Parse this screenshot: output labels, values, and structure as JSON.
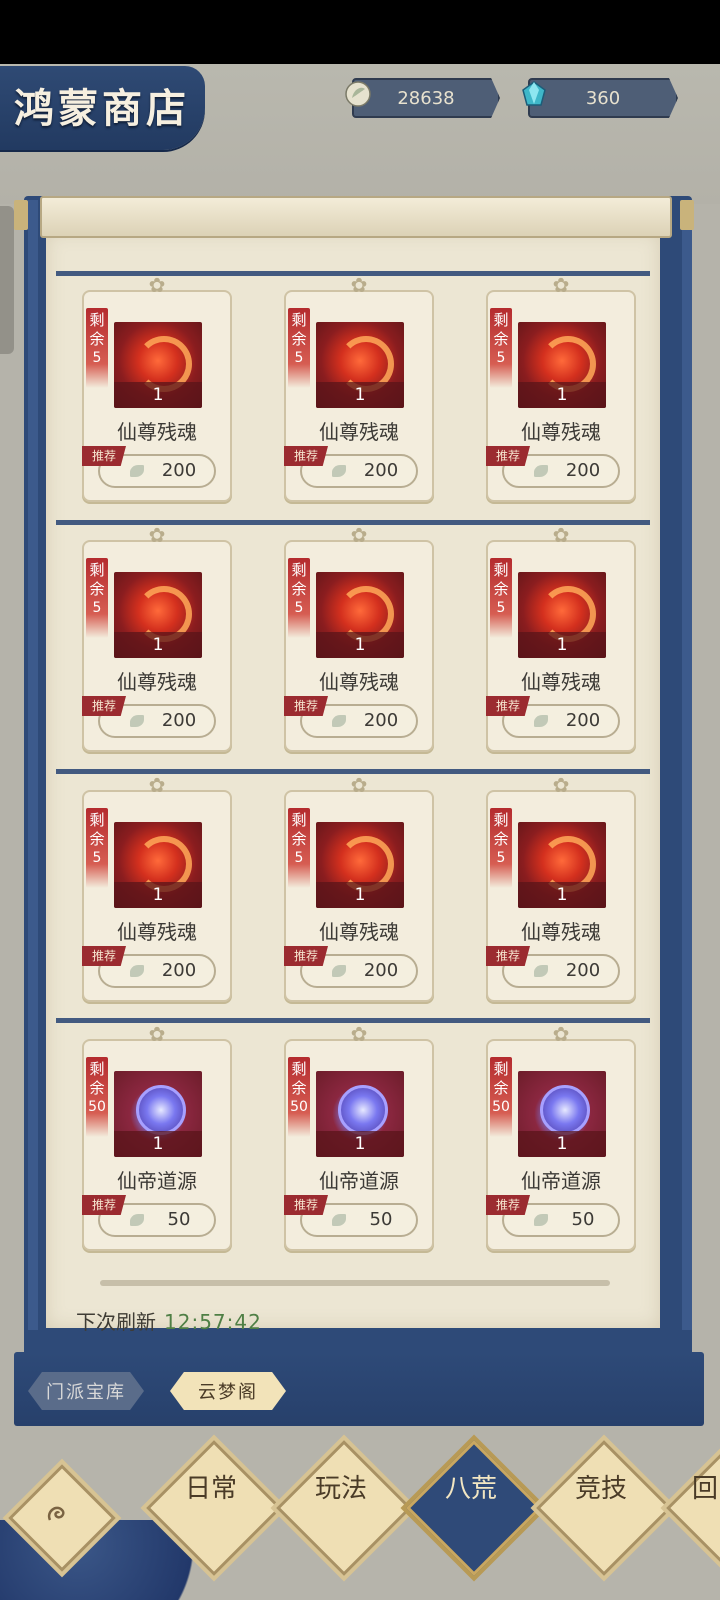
{
  "header": {
    "title": "鸿蒙商店",
    "currencies": [
      {
        "name": "leaf-currency-icon",
        "amount": "28638"
      },
      {
        "name": "gem-currency-icon",
        "amount": "360"
      }
    ]
  },
  "shop": {
    "rows": [
      {
        "items": [
          {
            "remain_label": "剩余",
            "remain_count": "5",
            "icon": "red-soul-icon",
            "quantity": "1",
            "name": "仙尊残魂",
            "tag": "推荐",
            "price": "200"
          },
          {
            "remain_label": "剩余",
            "remain_count": "5",
            "icon": "red-soul-icon",
            "quantity": "1",
            "name": "仙尊残魂",
            "tag": "推荐",
            "price": "200"
          },
          {
            "remain_label": "剩余",
            "remain_count": "5",
            "icon": "red-soul-icon",
            "quantity": "1",
            "name": "仙尊残魂",
            "tag": "推荐",
            "price": "200"
          }
        ]
      },
      {
        "items": [
          {
            "remain_label": "剩余",
            "remain_count": "5",
            "icon": "red-soul-icon",
            "quantity": "1",
            "name": "仙尊残魂",
            "tag": "推荐",
            "price": "200"
          },
          {
            "remain_label": "剩余",
            "remain_count": "5",
            "icon": "red-soul-icon",
            "quantity": "1",
            "name": "仙尊残魂",
            "tag": "推荐",
            "price": "200"
          },
          {
            "remain_label": "剩余",
            "remain_count": "5",
            "icon": "red-soul-icon",
            "quantity": "1",
            "name": "仙尊残魂",
            "tag": "推荐",
            "price": "200"
          }
        ]
      },
      {
        "items": [
          {
            "remain_label": "剩余",
            "remain_count": "5",
            "icon": "red-soul-icon",
            "quantity": "1",
            "name": "仙尊残魂",
            "tag": "推荐",
            "price": "200"
          },
          {
            "remain_label": "剩余",
            "remain_count": "5",
            "icon": "red-soul-icon",
            "quantity": "1",
            "name": "仙尊残魂",
            "tag": "推荐",
            "price": "200"
          },
          {
            "remain_label": "剩余",
            "remain_count": "5",
            "icon": "red-soul-icon",
            "quantity": "1",
            "name": "仙尊残魂",
            "tag": "推荐",
            "price": "200"
          }
        ]
      },
      {
        "items": [
          {
            "remain_label": "剩余",
            "remain_count": "50",
            "icon": "purple-orb-icon",
            "quantity": "1",
            "name": "仙帝道源",
            "tag": "推荐",
            "price": "50"
          },
          {
            "remain_label": "剩余",
            "remain_count": "50",
            "icon": "purple-orb-icon",
            "quantity": "1",
            "name": "仙帝道源",
            "tag": "推荐",
            "price": "50"
          },
          {
            "remain_label": "剩余",
            "remain_count": "50",
            "icon": "purple-orb-icon",
            "quantity": "1",
            "name": "仙帝道源",
            "tag": "推荐",
            "price": "50"
          }
        ]
      }
    ],
    "refresh_label": "下次刷新",
    "refresh_time": "12:57:42"
  },
  "tabs": [
    {
      "label": "门派宝库",
      "active": false
    },
    {
      "label": "云梦阁",
      "active": true
    }
  ],
  "bottom_nav": [
    {
      "label": "",
      "icon": "cloud-swirl-icon"
    },
    {
      "label": "日常"
    },
    {
      "label": "玩法"
    },
    {
      "label": "八荒",
      "selected": true
    },
    {
      "label": "竞技"
    },
    {
      "label": "回"
    }
  ],
  "colors": {
    "accent_blue": "#2e4a78",
    "parchment": "#ece6d3",
    "tag_red": "#9b2b30",
    "time_green": "#4f7f45"
  }
}
